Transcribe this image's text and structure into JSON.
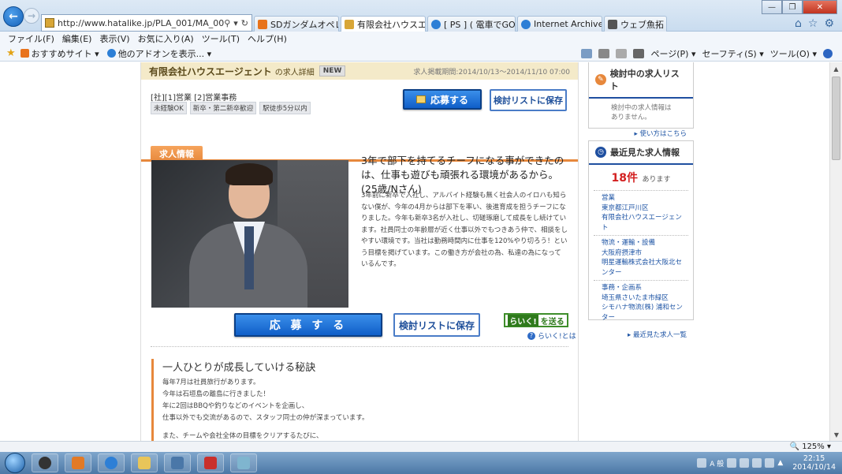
{
  "browser": {
    "url": "http://www.hatalike.jp/PLA_001/MA_00101/SA",
    "tabs": [
      {
        "label": "SDガンダムオペレー...",
        "icon_color": "#e8731c"
      },
      {
        "label": "有限会社ハウスエ...",
        "icon_color": "#d8a637",
        "active": true
      },
      {
        "label": "[ PS ] ( 電車でGO pr...",
        "icon_color": "#2d7fd6"
      },
      {
        "label": "Internet Archive: W...",
        "icon_color": "#2d7fd6"
      },
      {
        "label": "ウェブ魚拓",
        "icon_color": "#555555"
      }
    ],
    "menu": [
      "ファイル(F)",
      "編集(E)",
      "表示(V)",
      "お気に入り(A)",
      "ツール(T)",
      "ヘルプ(H)"
    ],
    "favorites": [
      "おすすめサイト ▾",
      "他のアドオンを表示... ▾"
    ],
    "commands": [
      "ページ(P) ▾",
      "セーフティ(S) ▾",
      "ツール(O) ▾"
    ],
    "zoom": "125%"
  },
  "job": {
    "company": "有限会社ハウスエージェント",
    "company_suffix": "の求人詳細",
    "new_badge": "NEW",
    "period": "求人掲載期間:2014/10/13〜2014/11/10 07:00",
    "title": "[社][1]営業 [2]営業事務",
    "tags": [
      "未経験OK",
      "新卒・第二新卒歓迎",
      "駅徒歩5分以内"
    ],
    "apply_label": "応募する",
    "apply_label_large": "応 募 す る",
    "save_label": "検討リストに保存",
    "tab_label": "求人情報",
    "headline": "3年で部下を持てるチーフになる事ができたのは、仕事も遊びも頑張れる環境があるから。(25歳/Nさん)",
    "body": "3年前に新卒で入社し、アルバイト経験も無く社会人のイロハも知らない僕が、今年の4月からは部下を率い、後進育成を担うチーフになりました。今年も新卒3名が入社し、切磋琢磨して成長をし続けています。社員同士の年齢層が近く仕事以外でもつきあう仲で、相談をしやすい環境です。当社は勤務時間内に仕事を120%やり切ろう！という目標を掲げています。この働き方が会社の為、私達の為になっているんです。",
    "raiku_logo": "らいく!",
    "raiku_send": "を送る",
    "raiku_help": "らいく!とは",
    "section_title": "一人ひとりが成長していける秘訣",
    "section_lines": [
      "毎年7月は社員旅行があります。",
      "今年は石垣島の離島に行きました！",
      "年に2回はBBQや釣りなどのイベントを企画し、",
      "仕事以外でも交流があるので、スタッフ同士の仲が深まっています。"
    ],
    "section_tail": "また、チームや会社全体の目標をクリアするたびに、"
  },
  "sidebar": {
    "shortlist_title": "検討中の求人リスト",
    "shortlist_empty_1": "検討中の求人情報は",
    "shortlist_empty_2": "ありません。",
    "shortlist_link": "▸ 使い方はこちら",
    "recent_title": "最近見た求人情報",
    "recent_count": "18件",
    "recent_count_unit": "あります",
    "recent_groups": [
      [
        "営業",
        "東京都江戸川区",
        "有限会社ハウスエージェント"
      ],
      [
        "物流・運輸・設備",
        "大阪府摂津市",
        "明星運輸株式会社大阪北センター"
      ],
      [
        "事務・企画系",
        "埼玉県さいたま市緑区",
        "シモハナ物流(株) 浦和センター"
      ]
    ],
    "recent_all": "▸ 最近見た求人一覧"
  },
  "taskbar": {
    "time": "22:15",
    "date": "2014/10/14",
    "ime": "A 般"
  }
}
